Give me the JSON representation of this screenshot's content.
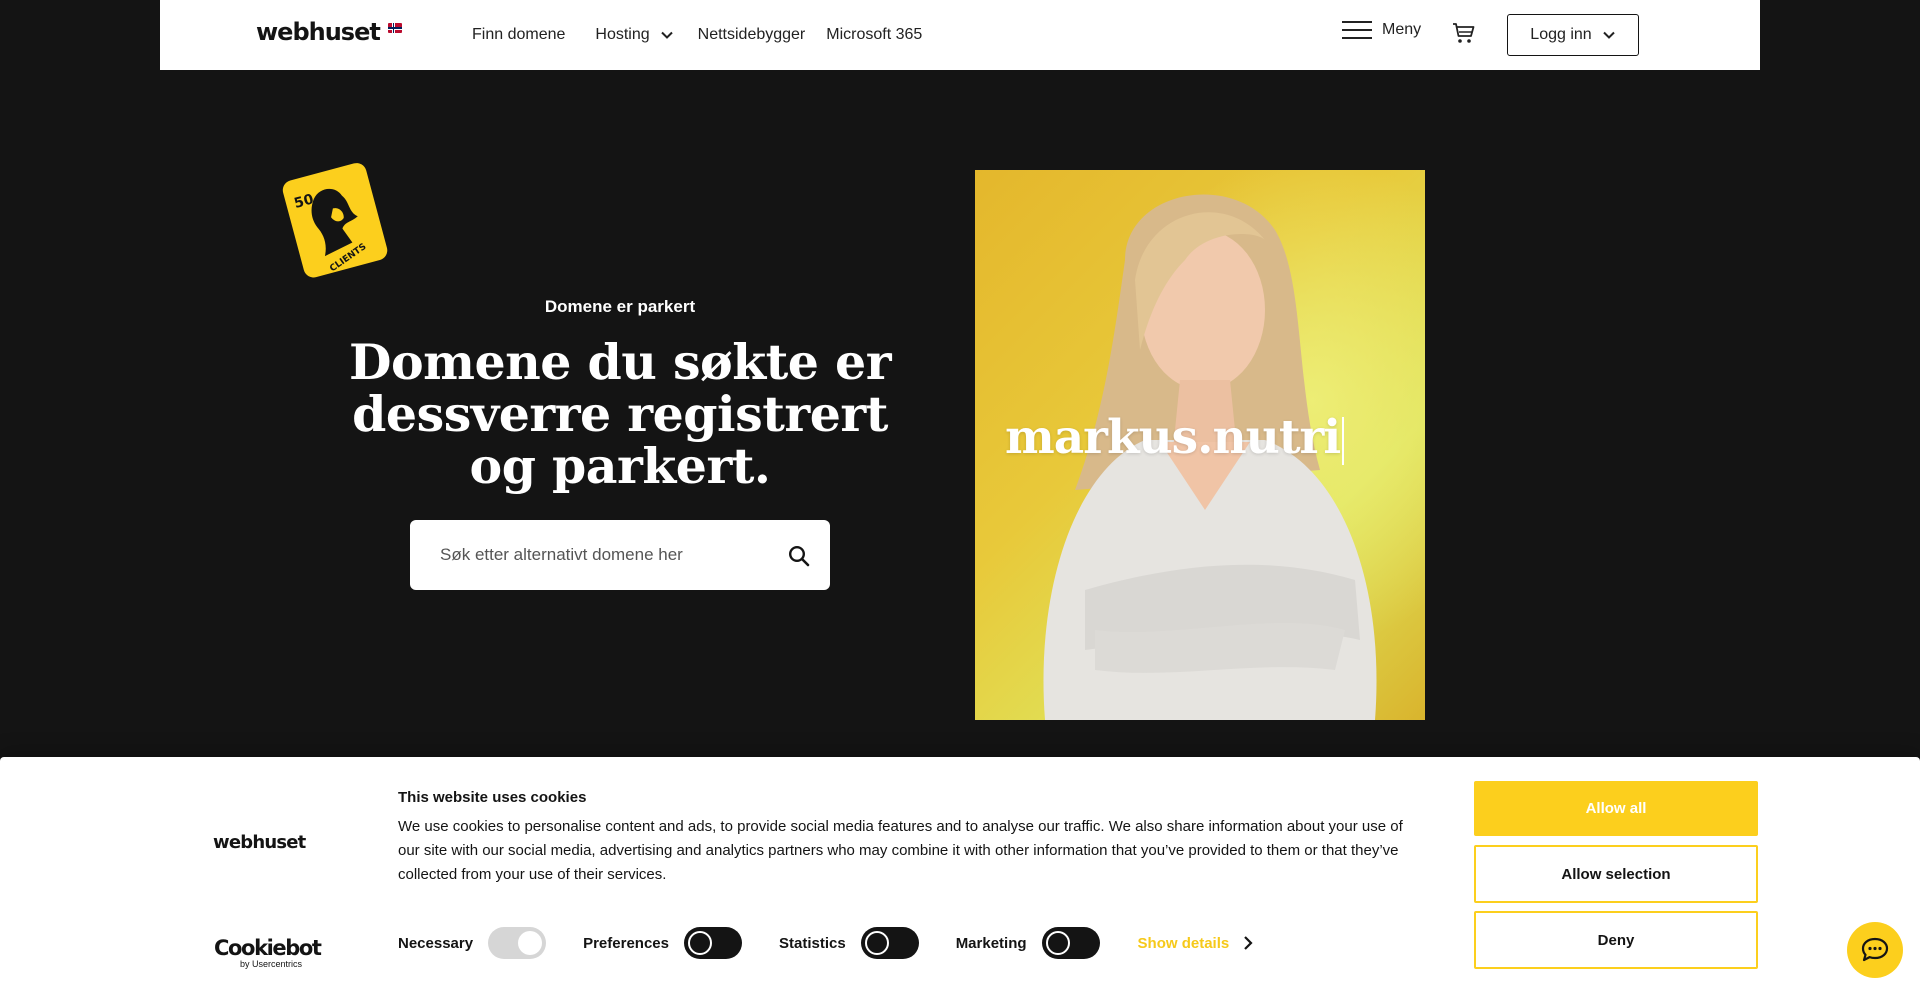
{
  "header": {
    "logo": "webhuset",
    "nav": [
      {
        "label": "Finn domene"
      },
      {
        "label": "Hosting"
      },
      {
        "label": "Nettsidebygger"
      },
      {
        "label": "Microsoft 365"
      }
    ],
    "menu_label": "Meny",
    "login_label": "Logg inn"
  },
  "badge": {
    "number": "50",
    "text": "CLIENTS"
  },
  "hero": {
    "subtitle": "Domene er parkert",
    "title": "Domene du søkte er dessverre registrert og parkert.",
    "search_placeholder": "Søk etter alternativt domene her",
    "typed_domain": "markus.nutri"
  },
  "cookie": {
    "logo": "webhuset",
    "title": "This website uses cookies",
    "text": "We use cookies to personalise content and ads, to provide social media features and to analyse our traffic. We also share information about your use of our site with our social media, advertising and analytics partners who may combine it with other information that you’ve provided to them or that they’ve collected from your use of their services.",
    "consents": [
      {
        "label": "Necessary",
        "checked": true
      },
      {
        "label": "Preferences",
        "checked": false
      },
      {
        "label": "Statistics",
        "checked": false
      },
      {
        "label": "Marketing",
        "checked": false
      }
    ],
    "show_details": "Show details",
    "allow_all": "Allow all",
    "allow_selection": "Allow selection",
    "deny": "Deny",
    "cookiebot": "Cookiebot",
    "cookiebot_by": "by Usercentrics"
  },
  "colors": {
    "background": "#141414",
    "accent_yellow": "#fccf1d",
    "header_bg": "#ffffff"
  }
}
